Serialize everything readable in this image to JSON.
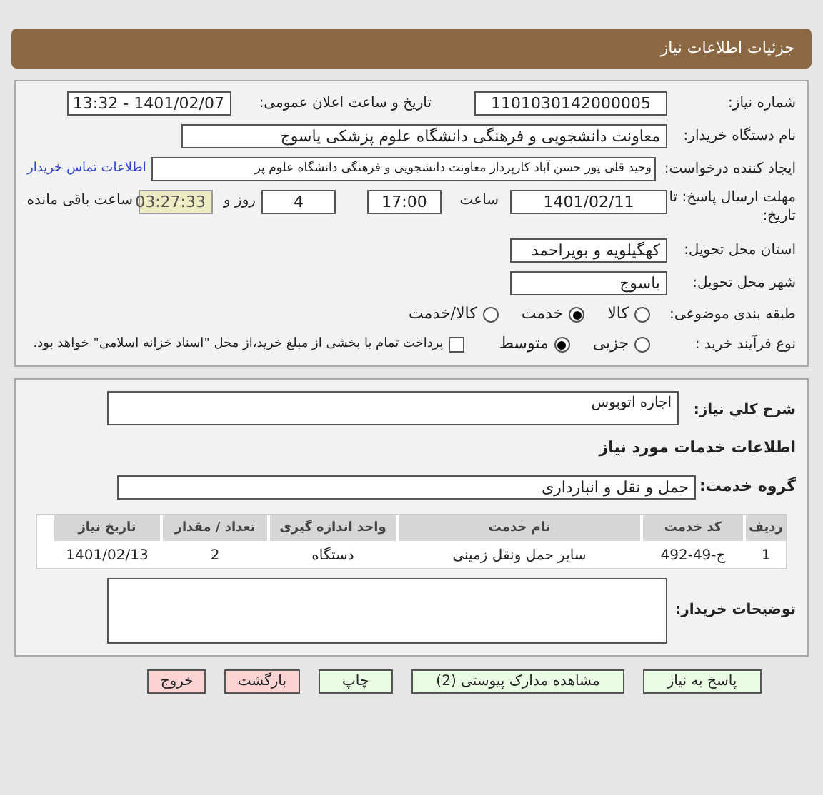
{
  "header": {
    "title": "جزئیات اطلاعات نیاز"
  },
  "need_number": {
    "label": "شماره نیاز:",
    "value": "1101030142000005"
  },
  "announce": {
    "label": "تاریخ و ساعت اعلان عمومی:",
    "value": "1401/02/07 - 13:32"
  },
  "buyer": {
    "label": "نام دستگاه خریدار:",
    "value": "معاونت دانشجویی و فرهنگی دانشگاه علوم پزشکی یاسوج"
  },
  "creator": {
    "label": "ایجاد کننده درخواست:",
    "value": "وحید قلی پور حسن آباد کارپرداز معاونت دانشجویی و فرهنگی دانشگاه علوم پز",
    "link": "اطلاعات تماس خریدار"
  },
  "deadline": {
    "label": "مهلت ارسال پاسخ: تا تاریخ:",
    "date": "1401/02/11",
    "time_label": "ساعت",
    "time": "17:00",
    "days": "4",
    "days_label": "روز و",
    "remaining": "03:27:33",
    "remaining_label": "ساعت باقی مانده"
  },
  "province": {
    "label": "استان محل تحویل:",
    "value": "کهگیلویه و بویراحمد"
  },
  "city": {
    "label": "شهر محل تحویل:",
    "value": "یاسوج"
  },
  "category": {
    "label": "طبقه بندی موضوعی:",
    "options": [
      {
        "label": "کالا",
        "selected": false
      },
      {
        "label": "خدمت",
        "selected": true
      },
      {
        "label": "کالا/خدمت",
        "selected": false
      }
    ]
  },
  "purchase_type": {
    "label": "نوع فرآیند خرید :",
    "options": [
      {
        "label": "جزیی",
        "selected": false
      },
      {
        "label": "متوسط",
        "selected": true
      }
    ],
    "payment": {
      "label": "پرداخت تمام یا بخشی از مبلغ خرید،از محل \"اسناد خزانه اسلامی\" خواهد بود.",
      "checked": false
    }
  },
  "description": {
    "label": "شرح کلي نياز:",
    "value": "اجاره اتوبوس"
  },
  "services_title": "اطلاعات خدمات مورد نیاز",
  "service_group": {
    "label": "گروه خدمت:",
    "value": "حمل و نقل و انبارداری"
  },
  "table": {
    "columns": [
      "ردیف",
      "کد خدمت",
      "نام خدمت",
      "واحد اندازه گیری",
      "تعداد / مقدار",
      "تاریخ نیاز"
    ],
    "rows": [
      [
        "1",
        "ج-49-492",
        "سایر حمل ونقل زمینی",
        "دستگاه",
        "2",
        "1401/02/13"
      ]
    ]
  },
  "buyer_notes": {
    "label": "توضیحات خریدار:"
  },
  "buttons": [
    {
      "label": "پاسخ به نیاز",
      "kind": "green"
    },
    {
      "label": "مشاهده مدارک پیوستی (2)",
      "kind": "green"
    },
    {
      "label": "چاپ",
      "kind": "green"
    },
    {
      "label": "بازگشت",
      "kind": "red"
    },
    {
      "label": "خروج",
      "kind": "red"
    }
  ]
}
